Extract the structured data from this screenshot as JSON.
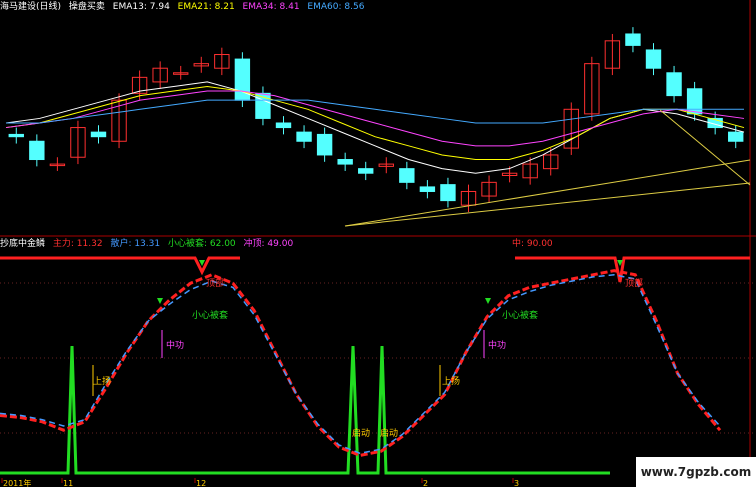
{
  "colors": {
    "bg": "#000000",
    "up": "#ff3030",
    "down": "#54ffff",
    "ema13": "#ffffff",
    "ema21": "#ffff00",
    "ema34": "#ff44ff",
    "ema60": "#44aaff",
    "main": "#ff2020",
    "retail": "#4499ff",
    "pulse": "#22dd22",
    "cap": "#ff2020"
  },
  "header_top": {
    "title": "海马建设(日线)",
    "indicator": "操盘买卖",
    "ema13": "EMA13: 7.94",
    "ema21": "EMA21: 8.21",
    "ema34": "EMA34: 8.41",
    "ema60": "EMA60: 8.56"
  },
  "header_bottom": {
    "title": "抄底中金鳞",
    "main": "主力: 11.32",
    "retail": "散户: 13.31",
    "caution": "小心被套: 62.00",
    "rush": "冲顶: 49.00",
    "right_value": "中: 90.00"
  },
  "annotations": [
    {
      "text": "顶部",
      "color": "#ff3030"
    },
    {
      "text": "小心被套",
      "color": "#22dd22"
    },
    {
      "text": "中功",
      "color": "#ff44ff"
    },
    {
      "text": "上扬",
      "color": "#ffcc00"
    },
    {
      "text": "启动",
      "color": "#ffcc00"
    },
    {
      "text": "启动",
      "color": "#ffcc00"
    },
    {
      "text": "小心被套",
      "color": "#22dd22"
    },
    {
      "text": "中功",
      "color": "#ff44ff"
    },
    {
      "text": "上扬",
      "color": "#ffcc00"
    },
    {
      "text": "顶部",
      "color": "#ff3030"
    }
  ],
  "date_ticks": [
    "2011年",
    "11",
    "12",
    "2",
    "3"
  ],
  "watermark": "www.7gpzb.com",
  "chart_data": [
    {
      "type": "candlestick",
      "title": "操盘买卖",
      "series": [
        {
          "name": "EMA13",
          "values": [
            8.3,
            8.4,
            8.6,
            8.8,
            9.0,
            9.1,
            9.2,
            9.0,
            8.7,
            8.4,
            8.1,
            7.8,
            7.5,
            7.3,
            7.2,
            7.3,
            7.6,
            8.0,
            8.4,
            8.6,
            8.5,
            8.3,
            8.1
          ]
        },
        {
          "name": "EMA21",
          "values": [
            8.2,
            8.3,
            8.5,
            8.7,
            8.9,
            9.0,
            9.1,
            9.0,
            8.8,
            8.6,
            8.3,
            8.0,
            7.8,
            7.6,
            7.5,
            7.5,
            7.7,
            8.0,
            8.4,
            8.6,
            8.6,
            8.4,
            8.2
          ]
        },
        {
          "name": "EMA34",
          "values": [
            8.2,
            8.3,
            8.4,
            8.6,
            8.8,
            8.9,
            9.0,
            9.0,
            8.9,
            8.7,
            8.5,
            8.3,
            8.1,
            7.9,
            7.8,
            7.8,
            7.9,
            8.1,
            8.3,
            8.5,
            8.6,
            8.5,
            8.4
          ]
        },
        {
          "name": "EMA60",
          "values": [
            8.3,
            8.3,
            8.4,
            8.5,
            8.6,
            8.7,
            8.8,
            8.8,
            8.8,
            8.8,
            8.7,
            8.6,
            8.5,
            8.4,
            8.3,
            8.3,
            8.3,
            8.4,
            8.5,
            8.6,
            8.6,
            8.6,
            8.6
          ]
        }
      ],
      "closes": [
        8.0,
        7.5,
        7.4,
        8.2,
        8.0,
        8.8,
        9.3,
        9.5,
        9.4,
        9.6,
        9.8,
        8.8,
        8.4,
        8.2,
        7.9,
        7.6,
        7.4,
        7.2,
        7.4,
        7.0,
        6.8,
        6.6,
        6.8,
        7.0,
        7.2,
        7.4,
        7.6,
        8.6,
        9.6,
        10.1,
        10.0,
        9.5,
        8.9,
        8.5,
        8.2,
        7.9
      ]
    },
    {
      "type": "line",
      "title": "抄底中金鳞",
      "ylim": [
        0,
        100
      ],
      "series": [
        {
          "name": "主力",
          "values": [
            25,
            24,
            22,
            18,
            22,
            38,
            55,
            70,
            80,
            88,
            92,
            88,
            75,
            55,
            35,
            20,
            10,
            6,
            8,
            15,
            25,
            35,
            55,
            72,
            82,
            86,
            88,
            90,
            92,
            94,
            92,
            70,
            45,
            30,
            18
          ]
        },
        {
          "name": "散户",
          "values": [
            26,
            25,
            23,
            20,
            23,
            40,
            56,
            70,
            78,
            85,
            89,
            86,
            73,
            54,
            35,
            21,
            11,
            7,
            9,
            16,
            26,
            36,
            55,
            71,
            80,
            84,
            87,
            89,
            91,
            92,
            90,
            68,
            45,
            31,
            20
          ]
        }
      ]
    }
  ]
}
